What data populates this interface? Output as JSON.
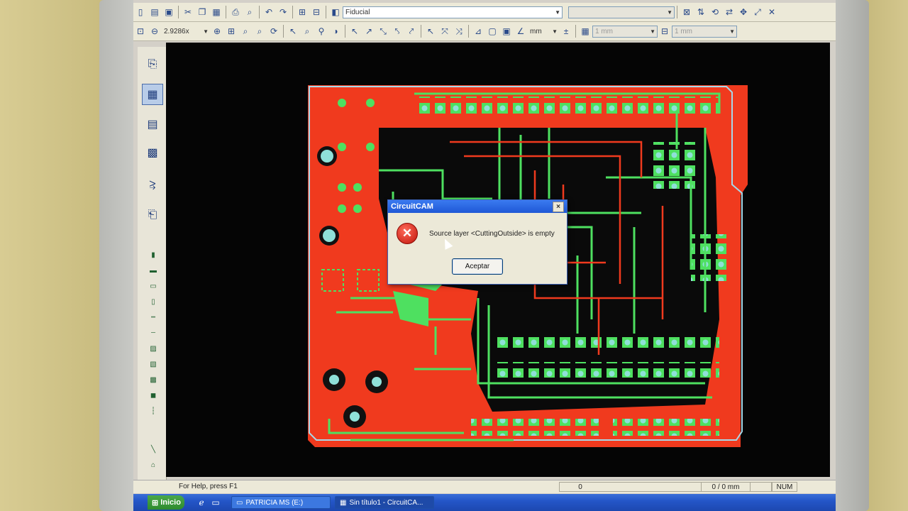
{
  "toolbar1": {
    "layer_select": "Fiducial"
  },
  "toolbar2": {
    "zoom_value": "2.9286x",
    "unit_select": "mm",
    "grid_value_1": "1 mm",
    "grid_value_2": "1 mm"
  },
  "status": {
    "help_text": "For Help, press F1",
    "counter": "0",
    "coords": "0 / 0 mm",
    "num": "NUM"
  },
  "taskbar": {
    "start_label": "Inicio",
    "task1": "PATRICIA MS (E:)",
    "task2": "Sin título1 - CircuitCA..."
  },
  "dialog": {
    "title": "CircuitCAM",
    "message": "Source layer <CuttingOutside> is empty",
    "ok_label": "Aceptar",
    "close_label": "×",
    "icon_glyph": "✕"
  },
  "colors": {
    "copper": "#f03a1e",
    "traces": "#4ee060",
    "pads": "#8fe0d8",
    "background": "#050505",
    "outline": "#a8d8e8"
  },
  "icons": {
    "error": "error-icon"
  }
}
